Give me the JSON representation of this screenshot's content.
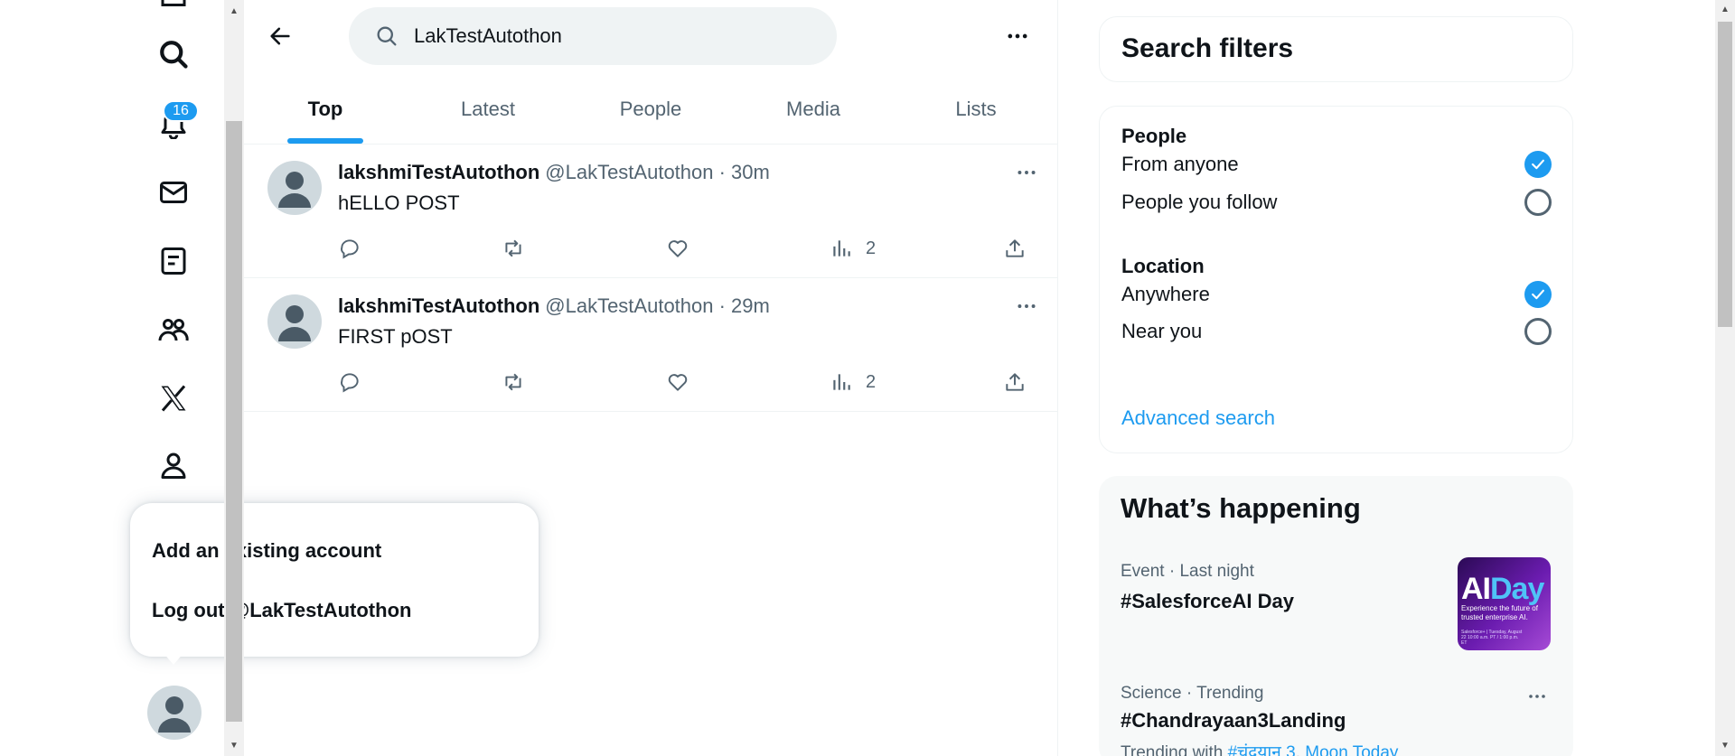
{
  "search": {
    "value": "LakTestAutothon"
  },
  "tabs": [
    {
      "label": "Top",
      "active": true
    },
    {
      "label": "Latest",
      "active": false
    },
    {
      "label": "People",
      "active": false
    },
    {
      "label": "Media",
      "active": false
    },
    {
      "label": "Lists",
      "active": false
    }
  ],
  "nav": {
    "icons": [
      "home-icon",
      "search-icon",
      "notifications-icon",
      "messages-icon",
      "lists-icon",
      "communities-icon",
      "x-premium-icon",
      "profile-icon"
    ],
    "notification_count": "16"
  },
  "posts": [
    {
      "name": "lakshmiTestAutothon",
      "handle": "@LakTestAutothon · 30m",
      "text": "hELLO POST",
      "views": "2"
    },
    {
      "name": "lakshmiTestAutothon",
      "handle": "@LakTestAutothon · 29m",
      "text": "FIRST pOST",
      "views": "2"
    }
  ],
  "account_menu": {
    "add_account": "Add an existing account",
    "logout": "Log out @LakTestAutothon"
  },
  "search_filters": {
    "title": "Search filters",
    "people_heading": "People",
    "people_options": [
      {
        "label": "From anyone",
        "selected": true
      },
      {
        "label": "People you follow",
        "selected": false
      }
    ],
    "location_heading": "Location",
    "location_options": [
      {
        "label": "Anywhere",
        "selected": true
      },
      {
        "label": "Near you",
        "selected": false
      }
    ],
    "advanced_link": "Advanced search"
  },
  "whats_happening": {
    "title": "What’s happening",
    "trends": [
      {
        "meta": "Event · Last night",
        "title": "#SalesforceAI Day",
        "image": {
          "headline_a": "AI",
          "headline_b": "Day",
          "tagline": "Experience the future of trusted enterprise AI.",
          "fine_print": "Salesforce+ | Tuesday, August 22 10:00 a.m. PT / 1:00 p.m. ET"
        }
      },
      {
        "meta": "Science · Trending",
        "title": "#Chandrayaan3Landing",
        "sub_prefix": "Trending with",
        "sub_link_1": "#चंद्रयान 3",
        "sub_sep": ",",
        "sub_link_2": "Moon Today"
      }
    ]
  },
  "colors": {
    "accent": "#1d9bf0",
    "text": "#0f1419",
    "muted": "#536471",
    "border": "#eff3f4"
  }
}
